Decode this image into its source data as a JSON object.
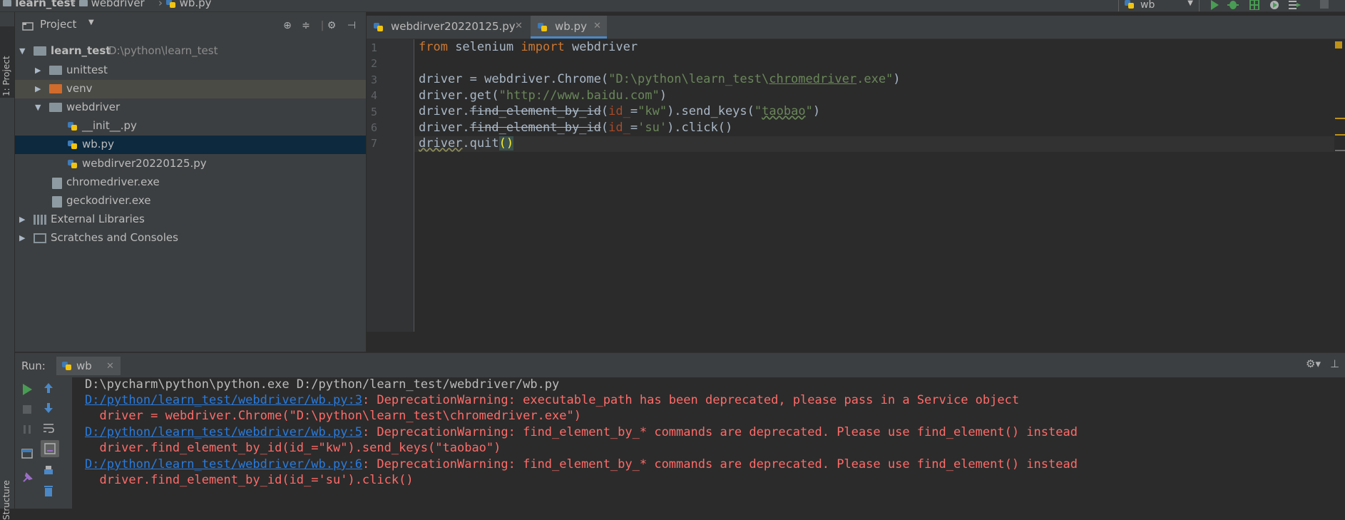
{
  "breadcrumb": {
    "project": "learn_test",
    "folder": "webdriver",
    "file": "wb.py"
  },
  "run_config": {
    "selected": "wb"
  },
  "project_panel": {
    "tab_label": "1: Project",
    "title": "Project",
    "tree": [
      {
        "label": "learn_test",
        "extra": "D:\\python\\learn_test",
        "kind": "root"
      },
      {
        "label": "unittest",
        "kind": "folder"
      },
      {
        "label": "venv",
        "kind": "folder-excluded"
      },
      {
        "label": "webdriver",
        "kind": "folder-open"
      },
      {
        "label": "__init__.py",
        "kind": "py"
      },
      {
        "label": "wb.py",
        "kind": "py",
        "selected": true
      },
      {
        "label": "webdirver20220125.py",
        "kind": "py"
      },
      {
        "label": "chromedriver.exe",
        "kind": "exe"
      },
      {
        "label": "geckodriver.exe",
        "kind": "exe"
      },
      {
        "label": "External Libraries",
        "kind": "libs"
      },
      {
        "label": "Scratches and Consoles",
        "kind": "scratches"
      }
    ]
  },
  "editor": {
    "tabs": [
      {
        "label": "webdirver20220125.py",
        "active": false
      },
      {
        "label": "wb.py",
        "active": true
      }
    ],
    "line_numbers": [
      "1",
      "2",
      "3",
      "4",
      "5",
      "6",
      "7"
    ],
    "code": {
      "l1_kw1": "from",
      "l1_mid": " selenium ",
      "l1_kw2": "import",
      "l1_end": " webdriver",
      "l3_a": "driver = webdriver.Chrome(",
      "l3_str1": "\"D:\\python\\learn_test\\",
      "l3_str2": "chromedriver",
      "l3_str3": ".exe\"",
      "l3_b": ")",
      "l4_a": "driver.get(",
      "l4_str": "\"http://www.baidu.com\"",
      "l4_b": ")",
      "l5_a": "driver.",
      "l5_fn": "find_element_by_id",
      "l5_b": "(",
      "l5_par": "id_",
      "l5_c": "=",
      "l5_str": "\"kw\"",
      "l5_d": ").send_keys(",
      "l5_str2a": "\"",
      "l5_str2b": "taobao",
      "l5_str2c": "\"",
      "l5_e": ")",
      "l6_a": "driver.",
      "l6_fn": "find_element_by_id",
      "l6_b": "(",
      "l6_par": "id_",
      "l6_c": "=",
      "l6_str": "'su'",
      "l6_d": ").click()",
      "l7_a": "driver",
      "l7_b": ".quit",
      "l7_paren": "()"
    }
  },
  "run_panel": {
    "label": "Run:",
    "tab": "wb",
    "structure_tab": "Structure",
    "console": {
      "cmd": "D:\\pycharm\\python\\python.exe D:/python/learn_test/webdriver/wb.py",
      "w1_link": "D:/python/learn_test/webdriver/wb.py:3",
      "w1_msg": ": DeprecationWarning: executable_path has been deprecated, please pass in a Service object",
      "w1_code": "  driver = webdriver.Chrome(\"D:\\python\\learn_test\\chromedriver.exe\")",
      "w2_link": "D:/python/learn_test/webdriver/wb.py:5",
      "w2_msg": ": DeprecationWarning: find_element_by_* commands are deprecated. Please use find_element() instead",
      "w2_code": "  driver.find_element_by_id(id_=\"kw\").send_keys(\"taobao\")",
      "w3_link": "D:/python/learn_test/webdriver/wb.py:6",
      "w3_msg": ": DeprecationWarning: find_element_by_* commands are deprecated. Please use find_element() instead",
      "w3_code": "  driver.find_element_by_id(id_='su').click()"
    }
  },
  "colors": {
    "background": "#2b2b2b",
    "panel": "#3c3f41",
    "keyword": "#cc7832",
    "string": "#6a8759",
    "error": "#ff6b68",
    "link": "#287bde",
    "selection": "#0d293e"
  }
}
